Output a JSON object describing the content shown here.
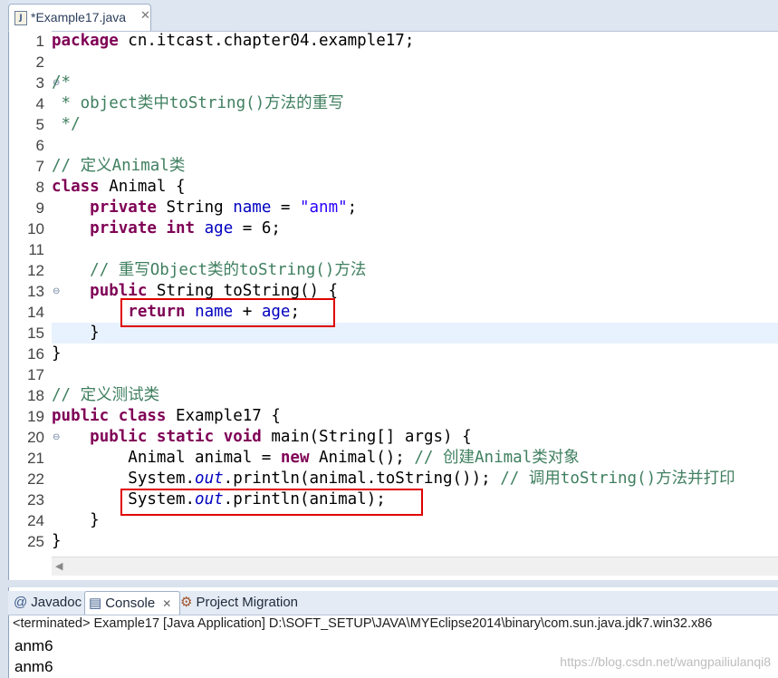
{
  "editor": {
    "tab_label": "*Example17.java",
    "tab_close": "✕",
    "file_icon_glyph": "J"
  },
  "code_lines": [
    {
      "n": "1",
      "segs": [
        {
          "t": "package",
          "c": "kw"
        },
        {
          "t": " cn.itcast.chapter04.example17;",
          "c": ""
        }
      ]
    },
    {
      "n": "2",
      "segs": []
    },
    {
      "n": "3",
      "fold": "⊖",
      "segs": [
        {
          "t": "/*",
          "c": "cm"
        }
      ]
    },
    {
      "n": "4",
      "segs": [
        {
          "t": " * object类中toString()方法的重写",
          "c": "cm"
        }
      ]
    },
    {
      "n": "5",
      "segs": [
        {
          "t": " */",
          "c": "cm"
        }
      ]
    },
    {
      "n": "6",
      "segs": []
    },
    {
      "n": "7",
      "segs": [
        {
          "t": "// 定义Animal类",
          "c": "cm"
        }
      ]
    },
    {
      "n": "8",
      "segs": [
        {
          "t": "class",
          "c": "kw"
        },
        {
          "t": " Animal {",
          "c": ""
        }
      ]
    },
    {
      "n": "9",
      "segs": [
        {
          "t": "    ",
          "c": ""
        },
        {
          "t": "private",
          "c": "kw"
        },
        {
          "t": " String ",
          "c": ""
        },
        {
          "t": "name",
          "c": "fld"
        },
        {
          "t": " = ",
          "c": ""
        },
        {
          "t": "\"anm\"",
          "c": "str"
        },
        {
          "t": ";",
          "c": ""
        }
      ]
    },
    {
      "n": "10",
      "segs": [
        {
          "t": "    ",
          "c": ""
        },
        {
          "t": "private",
          "c": "kw"
        },
        {
          "t": " ",
          "c": ""
        },
        {
          "t": "int",
          "c": "kw"
        },
        {
          "t": " ",
          "c": ""
        },
        {
          "t": "age",
          "c": "fld"
        },
        {
          "t": " = 6;",
          "c": ""
        }
      ]
    },
    {
      "n": "11",
      "segs": []
    },
    {
      "n": "12",
      "segs": [
        {
          "t": "    ",
          "c": ""
        },
        {
          "t": "// 重写Object类的toString()方法",
          "c": "cm"
        }
      ]
    },
    {
      "n": "13",
      "fold": "⊖",
      "segs": [
        {
          "t": "    ",
          "c": ""
        },
        {
          "t": "public",
          "c": "kw"
        },
        {
          "t": " String toString() {",
          "c": ""
        }
      ]
    },
    {
      "n": "14",
      "segs": [
        {
          "t": "        ",
          "c": ""
        },
        {
          "t": "return",
          "c": "kw"
        },
        {
          "t": " ",
          "c": ""
        },
        {
          "t": "name",
          "c": "fld"
        },
        {
          "t": " + ",
          "c": ""
        },
        {
          "t": "age",
          "c": "fld"
        },
        {
          "t": ";",
          "c": ""
        }
      ]
    },
    {
      "n": "15",
      "segs": [
        {
          "t": "    }",
          "c": ""
        }
      ]
    },
    {
      "n": "16",
      "segs": [
        {
          "t": "}",
          "c": ""
        }
      ]
    },
    {
      "n": "17",
      "segs": []
    },
    {
      "n": "18",
      "segs": [
        {
          "t": "// 定义测试类",
          "c": "cm"
        }
      ]
    },
    {
      "n": "19",
      "segs": [
        {
          "t": "public",
          "c": "kw"
        },
        {
          "t": " ",
          "c": ""
        },
        {
          "t": "class",
          "c": "kw"
        },
        {
          "t": " Example17 {",
          "c": ""
        }
      ]
    },
    {
      "n": "20",
      "fold": "⊖",
      "segs": [
        {
          "t": "    ",
          "c": ""
        },
        {
          "t": "public",
          "c": "kw"
        },
        {
          "t": " ",
          "c": ""
        },
        {
          "t": "static",
          "c": "kw"
        },
        {
          "t": " ",
          "c": ""
        },
        {
          "t": "void",
          "c": "kw"
        },
        {
          "t": " main(String[] args) {",
          "c": ""
        }
      ]
    },
    {
      "n": "21",
      "segs": [
        {
          "t": "        Animal animal = ",
          "c": ""
        },
        {
          "t": "new",
          "c": "kw"
        },
        {
          "t": " Animal(); ",
          "c": ""
        },
        {
          "t": "// 创建Animal类对象",
          "c": "cm"
        }
      ]
    },
    {
      "n": "22",
      "segs": [
        {
          "t": "        System.",
          "c": ""
        },
        {
          "t": "out",
          "c": "stat"
        },
        {
          "t": ".println(animal.toString()); ",
          "c": ""
        },
        {
          "t": "// 调用toString()方法并打印",
          "c": "cm"
        }
      ]
    },
    {
      "n": "23",
      "segs": [
        {
          "t": "        System.",
          "c": ""
        },
        {
          "t": "out",
          "c": "stat"
        },
        {
          "t": ".println(animal);",
          "c": ""
        }
      ]
    },
    {
      "n": "24",
      "segs": [
        {
          "t": "    }",
          "c": ""
        }
      ]
    },
    {
      "n": "25",
      "segs": [
        {
          "t": "}",
          "c": ""
        }
      ]
    }
  ],
  "console": {
    "tabs": [
      {
        "icon": "@",
        "label": "Javadoc"
      },
      {
        "icon": "▤",
        "label": "Console",
        "close": "✕"
      },
      {
        "icon": "⚙",
        "label": "Project Migration"
      }
    ],
    "status": "<terminated> Example17 [Java Application] D:\\SOFT_SETUP\\JAVA\\MYEclipse2014\\binary\\com.sun.java.jdk7.win32.x86",
    "output": [
      "anm6",
      "anm6"
    ]
  },
  "watermark": "https://blog.csdn.net/wangpailiulanqi8",
  "colors": {
    "keyword": "#7f0055",
    "comment": "#3f7f5f",
    "string": "#2a00ff",
    "field": "#0000c0",
    "highlight_box": "#e00000"
  }
}
